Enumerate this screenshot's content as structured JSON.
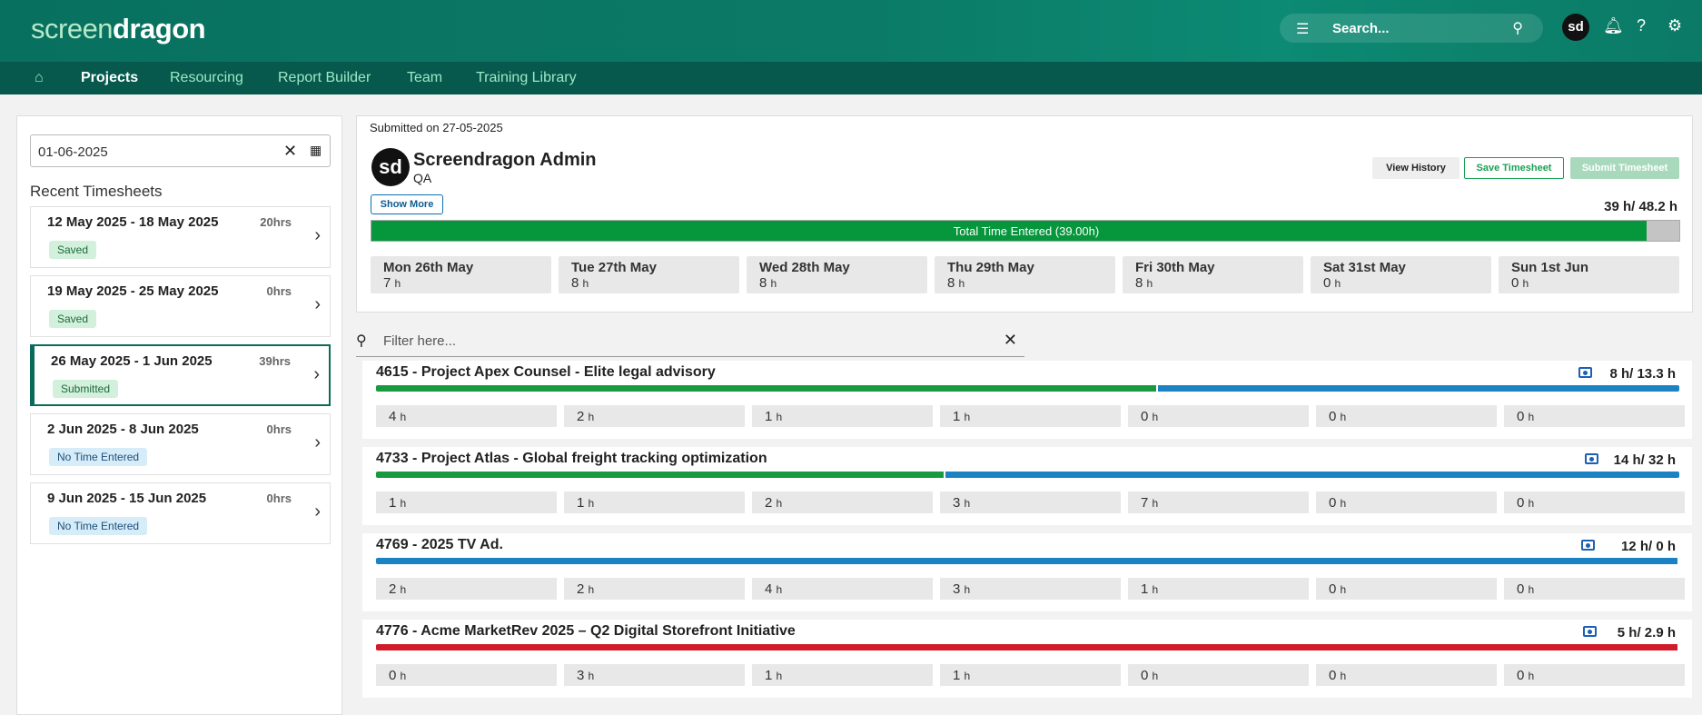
{
  "header": {
    "logo_a": "screen",
    "logo_b": "dragon",
    "search_placeholder": "Search...",
    "avatar_initials": "sd"
  },
  "nav": {
    "items": [
      "Projects",
      "Resourcing",
      "Report Builder",
      "Team",
      "Training Library"
    ]
  },
  "left": {
    "date_value": "01-06-2025",
    "recent_title": "Recent Timesheets",
    "timesheets": [
      {
        "range": "12 May 2025 - 18 May 2025",
        "hrs": "20hrs",
        "status": "Saved"
      },
      {
        "range": "19 May 2025 - 25 May 2025",
        "hrs": "0hrs",
        "status": "Saved"
      },
      {
        "range": "26 May 2025 - 1 Jun 2025",
        "hrs": "39hrs",
        "status": "Submitted"
      },
      {
        "range": "2 Jun 2025 - 8 Jun 2025",
        "hrs": "0hrs",
        "status": "No Time Entered"
      },
      {
        "range": "9 Jun 2025 - 15 Jun 2025",
        "hrs": "0hrs",
        "status": "No Time Entered"
      }
    ]
  },
  "summary": {
    "submitted_on": "Submitted on 27-05-2025",
    "avatar": "sd",
    "user_name": "Screendragon Admin",
    "user_role": "QA",
    "show_more": "Show More",
    "view_history": "View History",
    "save_timesheet": "Save Timesheet",
    "submit_timesheet": "Submit Timesheet",
    "total": "39 h/ 48.2 h",
    "progress_label": "Total Time Entered (39.00h)",
    "progress_fraction": 0.975,
    "days": [
      {
        "name": "Mon 26th May",
        "hours": "7"
      },
      {
        "name": "Tue 27th May",
        "hours": "8"
      },
      {
        "name": "Wed 28th May",
        "hours": "8"
      },
      {
        "name": "Thu 29th May",
        "hours": "8"
      },
      {
        "name": "Fri 30th May",
        "hours": "8"
      },
      {
        "name": "Sat 31st May",
        "hours": "0"
      },
      {
        "name": "Sun 1st Jun",
        "hours": "0"
      }
    ]
  },
  "filter": {
    "placeholder": "Filter here..."
  },
  "unit": "h",
  "projects": [
    {
      "title": "4615 - Project Apex Counsel - Elite legal advisory",
      "hours": "8 h/ 13.3 h",
      "bar": [
        {
          "color": "#1a9a3e",
          "fraction": 0.6
        },
        {
          "color": "#1b82c4",
          "fraction": 0.4
        }
      ],
      "days": [
        "4",
        "2",
        "1",
        "1",
        "0",
        "0",
        "0"
      ]
    },
    {
      "title": "4733 - Project Atlas - Global freight tracking optimization",
      "hours": "14 h/ 32 h",
      "bar": [
        {
          "color": "#1a9a3e",
          "fraction": 0.437
        },
        {
          "color": "#1b82c4",
          "fraction": 0.563
        }
      ],
      "days": [
        "1",
        "1",
        "2",
        "3",
        "7",
        "0",
        "0"
      ]
    },
    {
      "title": "4769 - 2025 TV Ad.",
      "hours": "12 h/ 0 h",
      "bar": [
        {
          "color": "#1b82c4",
          "fraction": 1.0
        }
      ],
      "days": [
        "2",
        "2",
        "4",
        "3",
        "1",
        "0",
        "0"
      ]
    },
    {
      "title": "4776 - Acme MarketRev 2025 – Q2 Digital Storefront Initiative",
      "hours": "5 h/ 2.9 h",
      "bar": [
        {
          "color": "#d11a2a",
          "fraction": 1.0
        }
      ],
      "days": [
        "0",
        "3",
        "1",
        "1",
        "0",
        "0",
        "0"
      ]
    }
  ]
}
